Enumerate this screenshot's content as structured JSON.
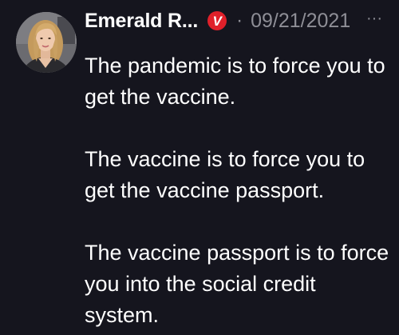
{
  "post": {
    "author_name": "Emerald R...",
    "verified_badge": "V",
    "separator": "·",
    "date": "09/21/2021",
    "more_icon": "more-horizontal-icon",
    "more_glyph": "···",
    "paragraphs": [
      "The pandemic is to force you to get the vaccine.",
      "The vaccine is to force you to get the vaccine passport.",
      "The vaccine passport is to force you into the social credit system."
    ]
  },
  "colors": {
    "background": "#15151e",
    "text": "#ffffff",
    "muted": "#8e8e96",
    "badge": "#e0202a"
  }
}
